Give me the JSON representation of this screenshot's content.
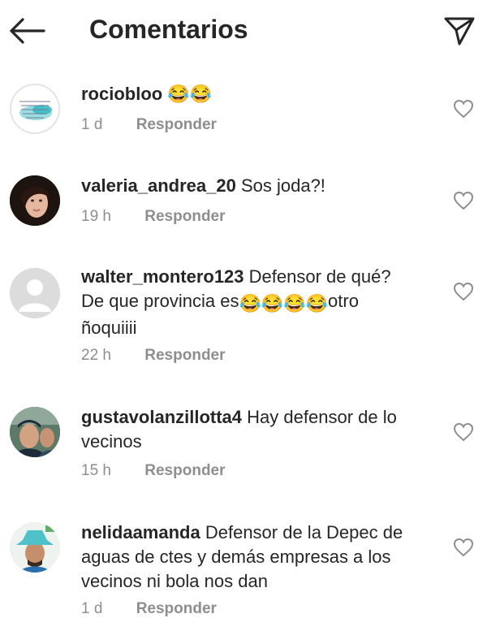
{
  "header": {
    "title": "Comentarios",
    "back_icon": "arrow-left-icon",
    "share_icon": "paper-plane-icon"
  },
  "comments": [
    {
      "username": "rociobloo",
      "text": "😂😂",
      "time": "1 d",
      "reply_label": "Responder",
      "avatar": "turquoise-feather-quote-image"
    },
    {
      "username": "valeria_andrea_20",
      "text": "Sos joda?!",
      "time": "19 h",
      "reply_label": "Responder",
      "avatar": "woman-portrait-photo"
    },
    {
      "username": "walter_montero123",
      "text_line1": "Defensor de qué?",
      "text_line2_prefix": "De que provincia es",
      "text_line2_suffix": "otro",
      "text_line3": "ñoquiiii",
      "emoji": "😂😂😂😂",
      "time": "22 h",
      "reply_label": "Responder",
      "avatar": "default-user-placeholder"
    },
    {
      "username": "gustavolanzillotta4",
      "text": "Hay defensor de lo vecinos",
      "time": "15 h",
      "reply_label": "Responder",
      "avatar": "man-with-cap-photo"
    },
    {
      "username": "nelidaamanda",
      "text": "Defensor de la Depec de aguas de ctes y demás empresas a los vecinos ni bola nos dan",
      "time": "1 d",
      "reply_label": "Responder",
      "avatar": "man-in-teal-hat-photo"
    }
  ],
  "colors": {
    "text": "#262626",
    "meta": "#8e8e8e",
    "icon": "#262626"
  }
}
